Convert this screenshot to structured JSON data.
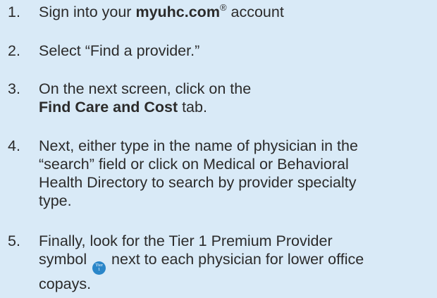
{
  "steps": [
    {
      "number": "1.",
      "pre": "Sign into your ",
      "link": "myuhc.com",
      "reg": "®",
      "post": " account"
    },
    {
      "number": "2.",
      "text": "Select “Find a provider.”"
    },
    {
      "number": "3.",
      "line1": "On the next screen, click on the",
      "bold": "Find Care and Cost",
      "post": " tab."
    },
    {
      "number": "4.",
      "lines": [
        "Next, either type in the name of physician in the",
        "“search” field or click on Medical or Behavioral",
        "Health Directory to search by provider specialty",
        "type."
      ]
    },
    {
      "number": "5.",
      "line1": "Finally, look for the Tier 1 Premium Provider",
      "pre": "symbol ",
      "post": " next to each physician for lower office",
      "line3": "copays.",
      "badge": {
        "top": "Tier",
        "bottom": "1",
        "color": "#2a86c9",
        "icon": "tier-1-badge-icon"
      }
    }
  ],
  "colors": {
    "background": "#d9eaf7",
    "text": "#2b2b2b"
  }
}
